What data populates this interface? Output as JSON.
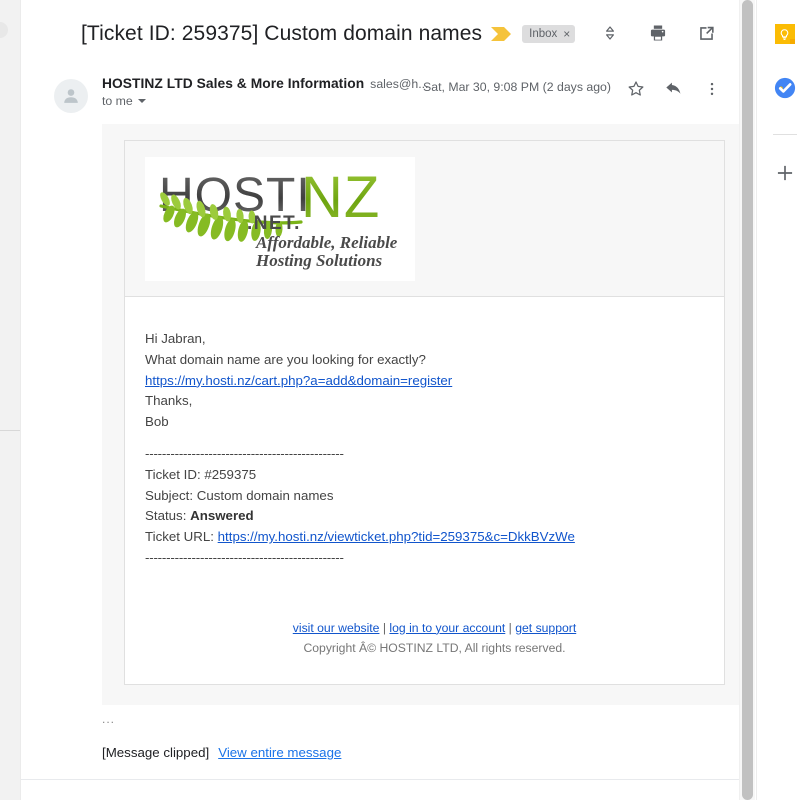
{
  "header": {
    "subject": "[Ticket ID: 259375] Custom domain names",
    "label_icon": "label-chevron-icon",
    "inbox_chip": "Inbox",
    "inbox_chip_close": "×",
    "icons": {
      "collapse_expand": "unfold-more-icon",
      "print": "print-icon",
      "open_new_window": "open-in-new-icon"
    },
    "accent_label_color": "#f5c33b"
  },
  "message": {
    "sender_name": "HOSTINZ LTD Sales & More Information",
    "sender_email": "sales@h...",
    "to": "to me",
    "date": "Sat, Mar 30, 9:08 PM (2 days ago)",
    "avatar_icon": "person-avatar-icon",
    "icons": {
      "star": "star-outline-icon",
      "reply": "reply-arrow-icon",
      "more": "more-vert-icon"
    }
  },
  "logo": {
    "text_dark": "HOSTI",
    "text_green": "NZ",
    "dot_net": ".NET.",
    "tagline_line1": "Affordable, Reliable",
    "tagline_line2": "Hosting Solutions",
    "green": "#7ab317",
    "dark": "#4a4a4a"
  },
  "body": {
    "greeting": "Hi Jabran,",
    "question": "What domain name are you looking for exactly?",
    "cart_link": "https://my.hosti.nz/cart.php?a=add&domain=register",
    "thanks": "Thanks,",
    "signature": "Bob",
    "rule_top": "-----------------------------------------------",
    "ticket_id_label": "Ticket ID: ",
    "ticket_id_value": "#259375",
    "subject_label": "Subject: ",
    "subject_value": "Custom domain names",
    "status_label": "Status: ",
    "status_value": "Answered",
    "ticket_url_label": "Ticket URL: ",
    "ticket_url_value": "https://my.hosti.nz/viewticket.php?tid=259375&c=DkkBVzWe",
    "rule_bottom": "-----------------------------------------------"
  },
  "footer": {
    "link_website": "visit our website",
    "sep1": " | ",
    "link_login": "log in to your account",
    "sep2": " | ",
    "link_support": "get support",
    "copyright": "Copyright Â© HOSTINZ LTD, All rights reserved."
  },
  "clipped": {
    "dots": "...",
    "label": "[Message clipped]",
    "link": "View entire message"
  },
  "right_sidebar": {
    "keep": "google-keep-icon",
    "tasks": "google-tasks-icon",
    "add": "add-on-plus-icon",
    "keep_color": "#fbbc04",
    "tasks_color": "#4285f4"
  }
}
